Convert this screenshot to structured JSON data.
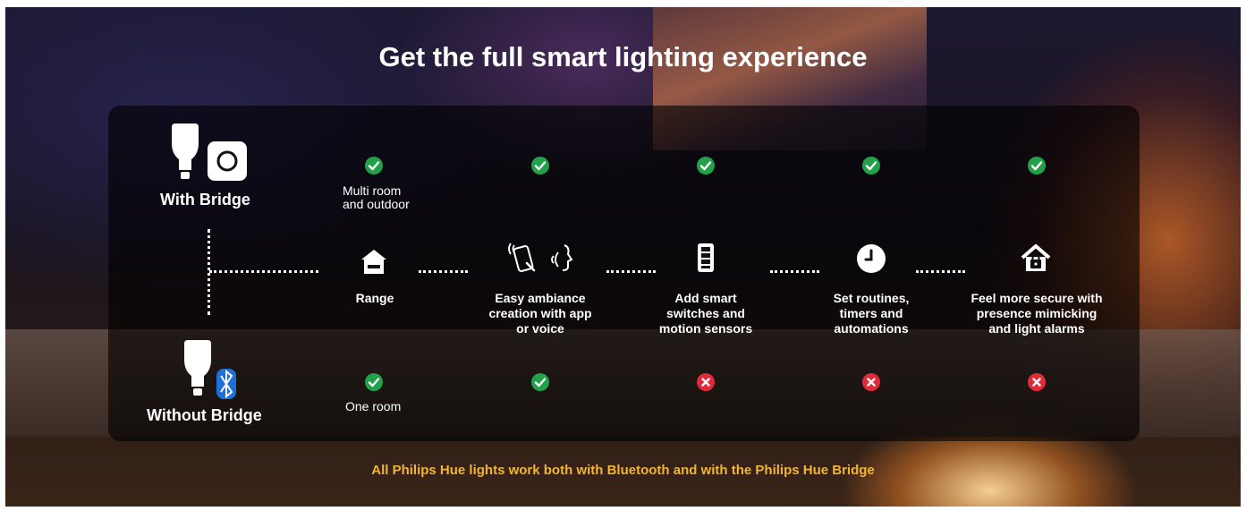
{
  "title": "Get the full smart lighting experience",
  "rows": {
    "with_bridge": "With Bridge",
    "without_bridge": "Without Bridge"
  },
  "features": [
    {
      "label": "Range",
      "with": true,
      "without": true,
      "with_text": "Multi room\nand outdoor",
      "without_text": "One room",
      "icon": "house-icon"
    },
    {
      "label": "Easy ambiance\ncreation with app\nor voice",
      "with": true,
      "without": true,
      "with_text": "",
      "without_text": "",
      "icon": "app-voice-icon"
    },
    {
      "label": "Add smart\nswitches and\nmotion sensors",
      "with": true,
      "without": false,
      "with_text": "",
      "without_text": "",
      "icon": "switch-icon"
    },
    {
      "label": "Set routines,\ntimers and\nautomations",
      "with": true,
      "without": false,
      "with_text": "",
      "without_text": "",
      "icon": "clock-icon"
    },
    {
      "label": "Feel more secure with\npresence mimicking\nand light alarms",
      "with": true,
      "without": false,
      "with_text": "",
      "without_text": "",
      "icon": "secure-home-icon"
    }
  ],
  "footer": "All Philips Hue lights work both with Bluetooth and with the Philips Hue Bridge",
  "colors": {
    "yes": "#22a04a",
    "no": "#e02a3a",
    "footer": "#f2b531"
  }
}
